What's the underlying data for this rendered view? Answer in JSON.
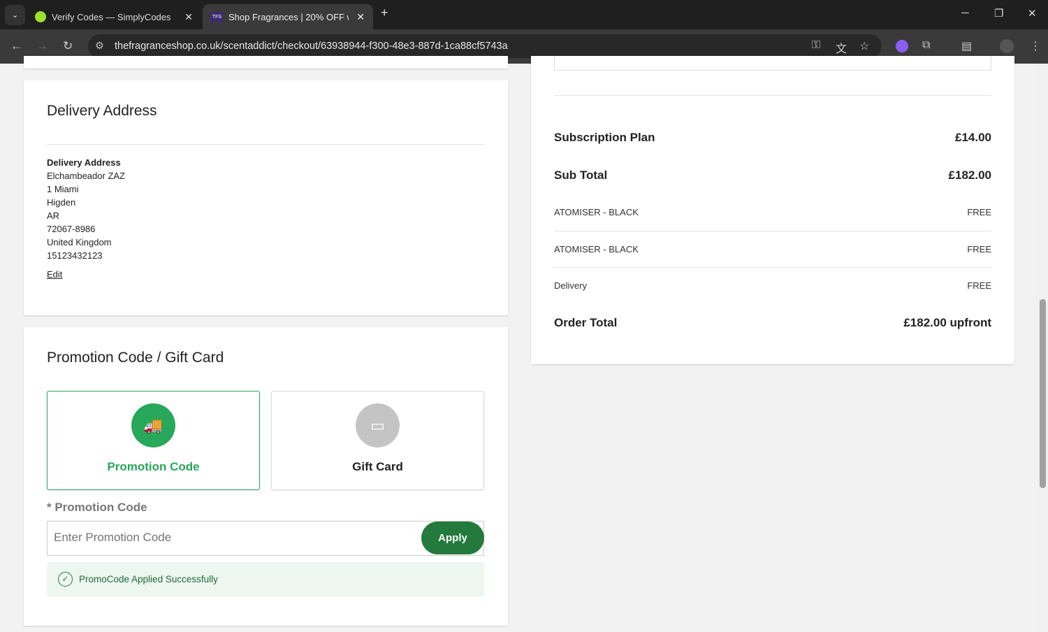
{
  "browser": {
    "tabs": [
      {
        "title": "Verify Codes — SimplyCodes"
      },
      {
        "title": "Shop Fragrances | 20% OFF wit",
        "favicon": "TFS"
      }
    ],
    "url": "thefragranceshop.co.uk/scentaddict/checkout/63938944-f300-48e3-887d-1ca88cf5743a"
  },
  "delivery": {
    "title": "Delivery Address",
    "label": "Delivery Address",
    "lines": [
      "Elchambeador ZAZ",
      "1 Miami",
      "Higden",
      "AR",
      "72067-8986",
      "United Kingdom",
      "15123432123"
    ],
    "edit": "Edit"
  },
  "promo": {
    "title": "Promotion Code / Gift Card",
    "options": [
      {
        "label": "Promotion Code"
      },
      {
        "label": "Gift Card"
      }
    ],
    "field_label": "* Promotion Code",
    "placeholder": "Enter Promotion Code",
    "apply": "Apply",
    "success": "PromoCode Applied Successfully"
  },
  "summary": {
    "rows": [
      {
        "label": "Subscription Plan",
        "value": "£14.00"
      },
      {
        "label": "Sub Total",
        "value": "£182.00"
      },
      {
        "label": "ATOMISER - BLACK",
        "value": "FREE"
      },
      {
        "label": "ATOMISER - BLACK",
        "value": "FREE"
      },
      {
        "label": "Delivery",
        "value": "FREE"
      },
      {
        "label": "Order Total",
        "value": "£182.00 upfront"
      }
    ]
  },
  "colors": {
    "accent": "#27a85a",
    "apply": "#237a3c",
    "success_bg": "#eef6f0"
  }
}
